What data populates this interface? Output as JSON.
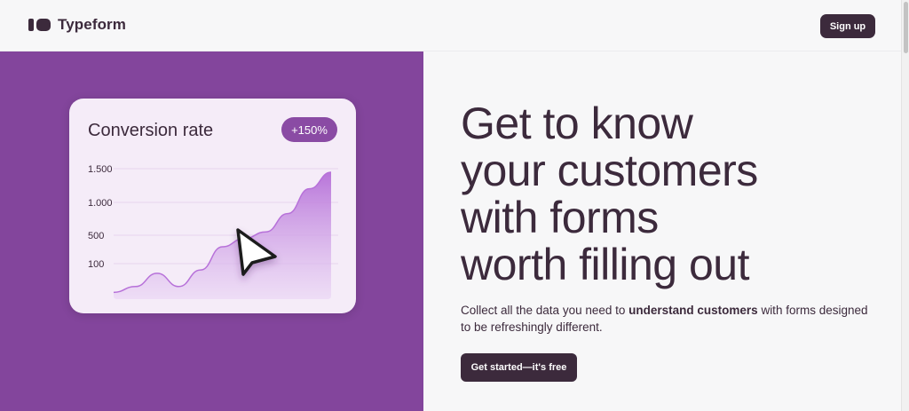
{
  "header": {
    "logo_text": "Typeform",
    "signup_label": "Sign up"
  },
  "hero": {
    "headline_lines": [
      "Get to know",
      "your customers",
      "with forms",
      "worth filling out"
    ],
    "subtext_before": "Collect all the data you need to ",
    "subtext_bold": "understand customers",
    "subtext_after": " with forms designed to be refreshingly different.",
    "cta_label": "Get started—it's free"
  },
  "card": {
    "title": "Conversion rate",
    "badge": "+150%",
    "cursor_icon": "play-cursor-icon"
  },
  "chart_data": {
    "type": "area",
    "title": "Conversion rate",
    "yticks": [
      "1.500",
      "1.000",
      "500",
      "100"
    ],
    "ytick_values": [
      1500,
      1000,
      500,
      100
    ],
    "ylim": [
      0,
      1500
    ],
    "x": [
      0,
      1,
      2,
      3,
      4,
      5,
      6,
      7,
      8,
      9,
      10
    ],
    "values": [
      50,
      120,
      280,
      120,
      320,
      600,
      700,
      780,
      1000,
      1300,
      1500
    ],
    "grid": true,
    "annotation": "+150%"
  },
  "colors": {
    "brand_dark": "#3c2a3c",
    "hero_purple": "#83459c",
    "area_fill": "#c383e0"
  }
}
